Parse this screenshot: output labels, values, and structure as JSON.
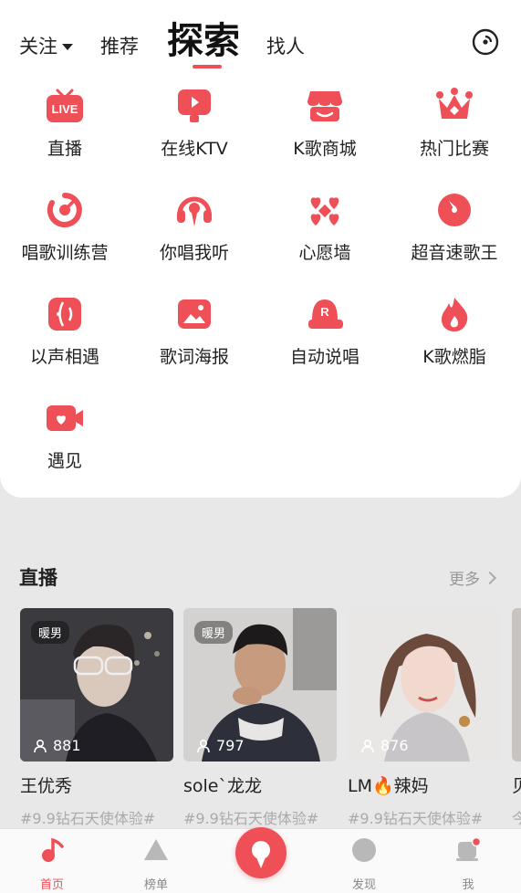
{
  "topnav": {
    "follow": "关注",
    "recommend": "推荐",
    "explore": "探索",
    "find": "找人"
  },
  "grid": [
    {
      "label": "直播",
      "icon": "live-tv-icon"
    },
    {
      "label": "在线KTV",
      "icon": "ktv-monitor-icon"
    },
    {
      "label": "K歌商城",
      "icon": "store-icon"
    },
    {
      "label": "热门比赛",
      "icon": "crown-icon"
    },
    {
      "label": "唱歌训练营",
      "icon": "training-ring-icon"
    },
    {
      "label": "你唱我听",
      "icon": "headphone-mic-icon"
    },
    {
      "label": "心愿墙",
      "icon": "hearts-icon"
    },
    {
      "label": "超音速歌王",
      "icon": "speed-circle-icon"
    },
    {
      "label": "以声相遇",
      "icon": "voice-meet-icon"
    },
    {
      "label": "歌词海报",
      "icon": "poster-icon"
    },
    {
      "label": "自动说唱",
      "icon": "cap-r-icon"
    },
    {
      "label": "K歌燃脂",
      "icon": "flame-icon"
    },
    {
      "label": "遇见",
      "icon": "video-heart-icon"
    }
  ],
  "live_section": {
    "title": "直播",
    "more": "更多",
    "cards": [
      {
        "tag": "暖男",
        "viewers": "881",
        "name": "王优秀",
        "topic": "#9.9钻石天使体验#"
      },
      {
        "tag": "暖男",
        "viewers": "797",
        "name": "sole`龙龙",
        "topic": "#9.9钻石天使体验#"
      },
      {
        "tag": "",
        "viewers": "876",
        "name": "LM🔥辣妈",
        "topic": "#9.9钻石天使体验#"
      },
      {
        "tag": "",
        "viewers": "",
        "name": "贝",
        "topic": "今"
      }
    ]
  },
  "tabbar": {
    "home": "首页",
    "charts": "榜单",
    "discover": "发现",
    "me": "我"
  },
  "colors": {
    "accent": "#ef4f57",
    "panel": "#ffffff",
    "background": "#e8e8e9"
  }
}
